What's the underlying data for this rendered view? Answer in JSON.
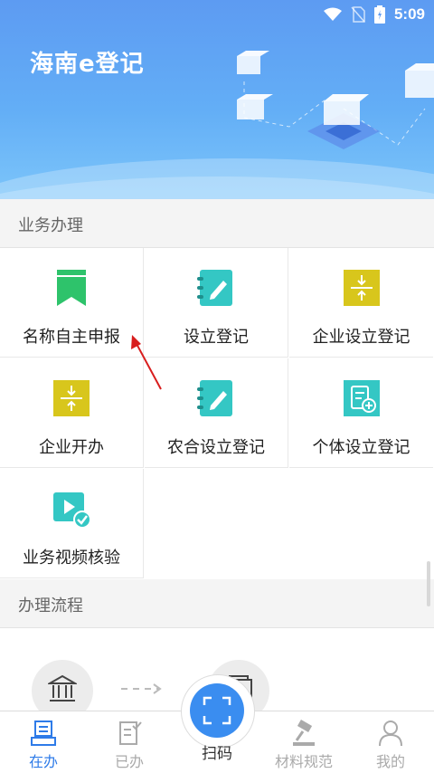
{
  "status": {
    "time": "5:09"
  },
  "header": {
    "title": "海南e登记"
  },
  "sections": {
    "business": "业务办理",
    "process": "办理流程"
  },
  "grid": {
    "items": [
      {
        "label": "名称自主申报",
        "icon": "bookmark-icon"
      },
      {
        "label": "设立登记",
        "icon": "notebook-edit-icon"
      },
      {
        "label": "企业设立登记",
        "icon": "compress-icon"
      },
      {
        "label": "企业开办",
        "icon": "compress-icon"
      },
      {
        "label": "农合设立登记",
        "icon": "notebook-edit-icon"
      },
      {
        "label": "个体设立登记",
        "icon": "document-add-icon"
      },
      {
        "label": "业务视频核验",
        "icon": "video-check-icon"
      }
    ]
  },
  "nav": {
    "items": [
      {
        "label": "在办",
        "icon": "in-progress-icon",
        "active": true
      },
      {
        "label": "已办",
        "icon": "done-icon"
      },
      {
        "label": "扫码",
        "icon": "scan-icon"
      },
      {
        "label": "材料规范",
        "icon": "gavel-icon"
      },
      {
        "label": "我的",
        "icon": "user-icon"
      }
    ]
  },
  "colors": {
    "accent": "#3a8df0",
    "green": "#2ec36b",
    "teal": "#34c7c4",
    "yellow": "#d8c61c",
    "arrow": "#d81e1e"
  }
}
